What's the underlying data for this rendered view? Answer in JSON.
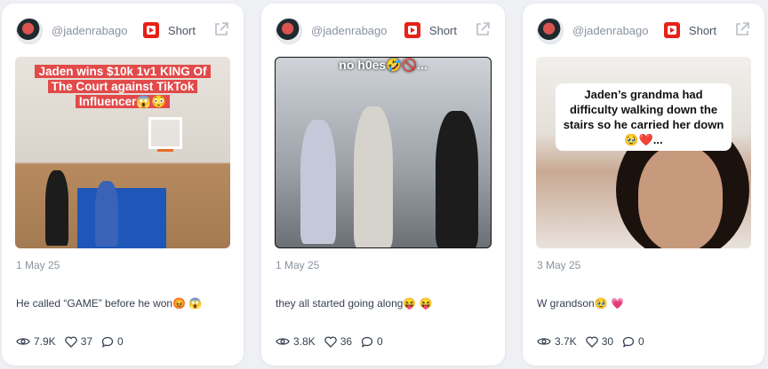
{
  "cards": [
    {
      "handle": "@jadenrabago",
      "type_label": "Short",
      "thumbnail_caption": "Jaden wins $10k 1v1 KING Of The Court against TikTok Influencer😱😳",
      "date": "1 May 25",
      "description": "He called “GAME” before he won😡 😱",
      "views": "7.9K",
      "likes": "37",
      "comments": "0"
    },
    {
      "handle": "@jadenrabago",
      "type_label": "Short",
      "thumbnail_caption": "no h0es🤣🚫...",
      "date": "1 May 25",
      "description": "they all started going along😝 😝",
      "views": "3.8K",
      "likes": "36",
      "comments": "0"
    },
    {
      "handle": "@jadenrabago",
      "type_label": "Short",
      "thumbnail_caption": "Jaden’s grandma had difficulty walking down the stairs so he carried her down🥹❤️...",
      "date": "3 May 25",
      "description": "W grandson🥹 💗",
      "views": "3.7K",
      "likes": "30",
      "comments": "0"
    }
  ],
  "colors": {
    "youtube_red": "#e62117",
    "muted_text": "#8a93a0",
    "body_text": "#374151"
  },
  "icons": [
    "youtube-icon",
    "external-link-icon",
    "eye-icon",
    "heart-icon",
    "comment-icon"
  ]
}
